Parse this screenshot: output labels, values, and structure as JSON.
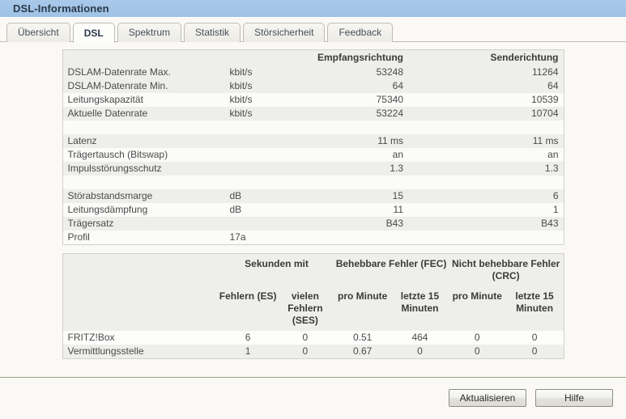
{
  "window": {
    "title": "DSL-Informationen"
  },
  "tabs": [
    {
      "label": "Übersicht",
      "active": false
    },
    {
      "label": "DSL",
      "active": true
    },
    {
      "label": "Spektrum",
      "active": false
    },
    {
      "label": "Statistik",
      "active": false
    },
    {
      "label": "Störsicherheit",
      "active": false
    },
    {
      "label": "Feedback",
      "active": false
    }
  ],
  "dsl_table": {
    "headers": {
      "label": "",
      "unit": "",
      "rx": "Empfangsrichtung",
      "tx": "Senderichtung"
    },
    "rows": [
      {
        "type": "data",
        "shade": true,
        "label": "DSLAM-Datenrate Max.",
        "unit": "kbit/s",
        "rx": "53248",
        "tx": "11264"
      },
      {
        "type": "data",
        "shade": true,
        "label": "DSLAM-Datenrate Min.",
        "unit": "kbit/s",
        "rx": "64",
        "tx": "64"
      },
      {
        "type": "data",
        "shade": false,
        "label": "Leitungskapazität",
        "unit": "kbit/s",
        "rx": "75340",
        "tx": "10539"
      },
      {
        "type": "data",
        "shade": true,
        "label": "Aktuelle Datenrate",
        "unit": "kbit/s",
        "rx": "53224",
        "tx": "10704"
      },
      {
        "type": "spacer"
      },
      {
        "type": "data",
        "shade": true,
        "label": "Latenz",
        "unit": "",
        "rx": "11 ms",
        "tx": "11 ms"
      },
      {
        "type": "data",
        "shade": false,
        "label": "Trägertausch (Bitswap)",
        "unit": "",
        "rx": "an",
        "tx": "an"
      },
      {
        "type": "data",
        "shade": true,
        "label": "Impulsstörungsschutz",
        "unit": "",
        "rx": "1.3",
        "tx": "1.3"
      },
      {
        "type": "spacer"
      },
      {
        "type": "data",
        "shade": true,
        "label": "Störabstandsmarge",
        "unit": "dB",
        "rx": "15",
        "tx": "6"
      },
      {
        "type": "data",
        "shade": false,
        "label": "Leitungsdämpfung",
        "unit": "dB",
        "rx": "11",
        "tx": "1"
      },
      {
        "type": "data",
        "shade": true,
        "label": "Trägersatz",
        "unit": "",
        "rx": "B43",
        "tx": "B43"
      },
      {
        "type": "data",
        "shade": false,
        "label": "Profil",
        "unit": "17a",
        "rx": "",
        "tx": ""
      }
    ]
  },
  "error_table": {
    "group_headers": {
      "corner": "",
      "seconds": "Sekunden mit",
      "fec": "Behebbare Fehler (FEC)",
      "crc": "Nicht behebbare Fehler (CRC)"
    },
    "sub_headers": {
      "corner": "",
      "es": "Fehlern (ES)",
      "ses": "vielen Fehlern (SES)",
      "fec_min": "pro Minute",
      "fec_15": "letzte 15 Minuten",
      "crc_min": "pro Minute",
      "crc_15": "letzte 15 Minuten"
    },
    "rows": [
      {
        "name": "FRITZ!Box",
        "es": "6",
        "ses": "0",
        "fec_min": "0.51",
        "fec_15": "464",
        "crc_min": "0",
        "crc_15": "0"
      },
      {
        "name": "Vermittlungsstelle",
        "es": "1",
        "ses": "0",
        "fec_min": "0.67",
        "fec_15": "0",
        "crc_min": "0",
        "crc_15": "0"
      }
    ]
  },
  "footer": {
    "refresh_label": "Aktualisieren",
    "help_label": "Hilfe"
  },
  "colors": {
    "titlebar": "#a3c5e7",
    "panel_border": "#d2d2c8",
    "row_shade": "#eeeeea",
    "page_bg": "#faf9f5"
  }
}
